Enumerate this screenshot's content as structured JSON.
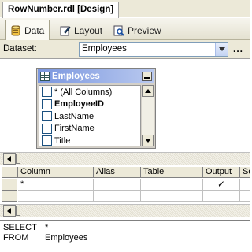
{
  "document_tab": {
    "title": "RowNumber.rdl [Design]"
  },
  "view_tabs": [
    {
      "label": "Data",
      "icon": "data-icon",
      "active": true
    },
    {
      "label": "Layout",
      "icon": "layout-icon",
      "active": false
    },
    {
      "label": "Preview",
      "icon": "preview-icon",
      "active": false
    }
  ],
  "dataset": {
    "label": "Dataset:",
    "selected": "Employees",
    "more_button": "..."
  },
  "diagram": {
    "table_title": "Employees",
    "columns": [
      {
        "name": "* (All Columns)",
        "bold": false
      },
      {
        "name": "EmployeeID",
        "bold": true
      },
      {
        "name": "LastName",
        "bold": false
      },
      {
        "name": "FirstName",
        "bold": false
      },
      {
        "name": "Title",
        "bold": false
      }
    ]
  },
  "criteria_grid": {
    "headers": [
      "Column",
      "Alias",
      "Table",
      "Output",
      "So"
    ],
    "rows": [
      {
        "column": "*",
        "alias": "",
        "table": "",
        "output": "✓"
      }
    ]
  },
  "sql": {
    "lines": [
      {
        "keyword": "SELECT",
        "text": "*"
      },
      {
        "keyword": "FROM",
        "text": "Employees"
      }
    ]
  },
  "colors": {
    "chrome": "#ece9d8",
    "title_bar_start": "#7a96df",
    "title_bar_end": "#b9c9ef"
  }
}
